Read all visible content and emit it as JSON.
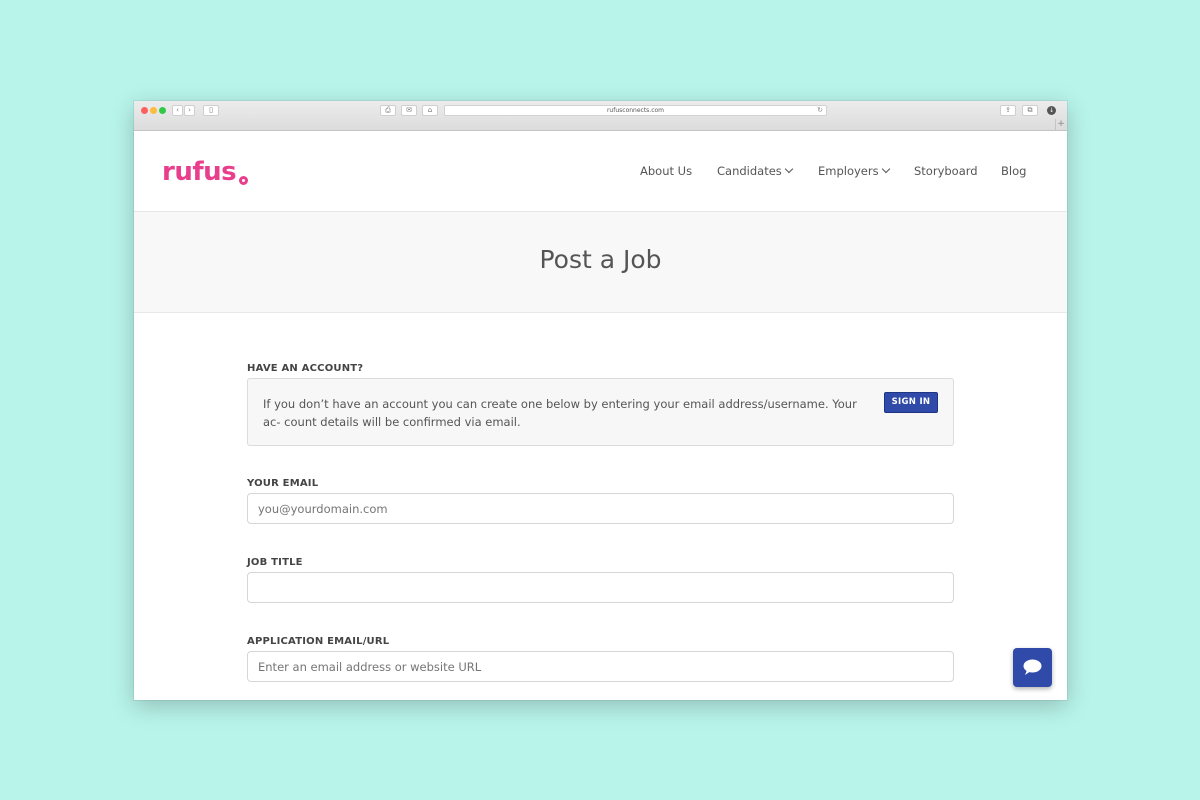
{
  "browser": {
    "url": "rufusconnects.com"
  },
  "brand": {
    "logo_text": "rufus",
    "accent_color": "#e83e8c",
    "button_color": "#2f4aa8"
  },
  "nav": {
    "items": [
      {
        "label": "About Us",
        "has_dropdown": false
      },
      {
        "label": "Candidates",
        "has_dropdown": true
      },
      {
        "label": "Employers",
        "has_dropdown": true
      },
      {
        "label": "Storyboard",
        "has_dropdown": false
      },
      {
        "label": "Blog",
        "has_dropdown": false
      }
    ]
  },
  "page": {
    "title": "Post a Job"
  },
  "form": {
    "account_label": "HAVE AN ACCOUNT?",
    "account_notice": "If you don’t have an account you can create one below by entering your email address/username. Your ac- count details will be confirmed via email.",
    "sign_in_label": "SIGN IN",
    "email_label": "YOUR EMAIL",
    "email_placeholder": "you@yourdomain.com",
    "job_title_label": "JOB TITLE",
    "job_title_placeholder": "",
    "application_label": "APPLICATION EMAIL/URL",
    "application_placeholder": "Enter an email address or website URL"
  },
  "icons": {
    "chat": "chat-bubble-icon",
    "dropdown": "chevron-down-icon"
  }
}
